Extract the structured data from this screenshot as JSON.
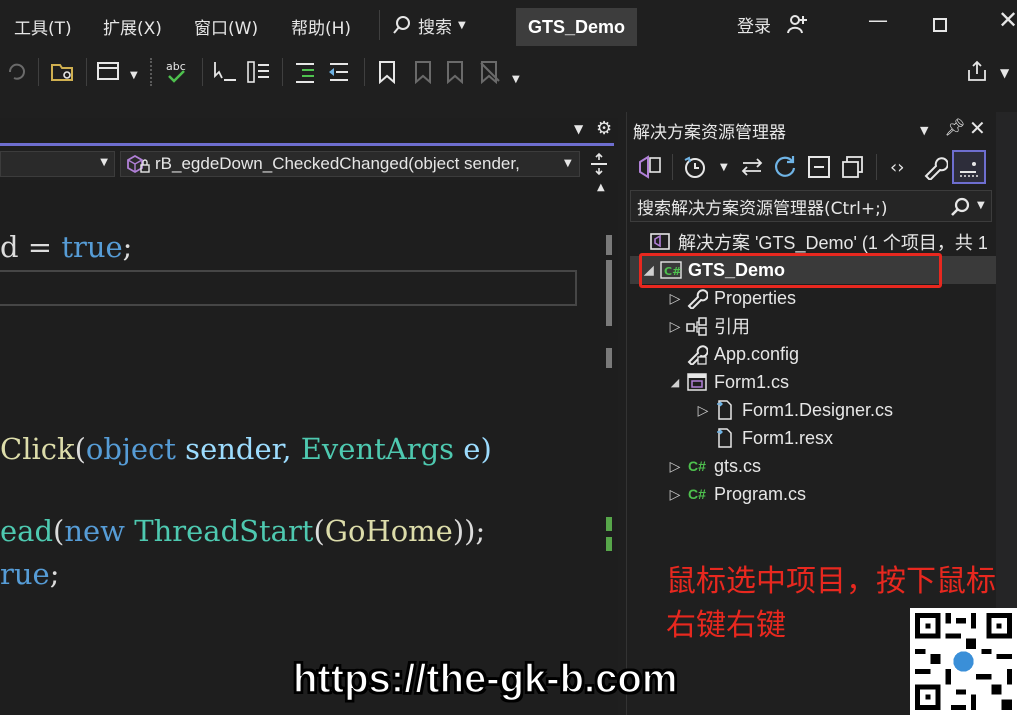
{
  "menu": {
    "items": [
      "工具(T)",
      "扩展(X)",
      "窗口(W)",
      "帮助(H)"
    ],
    "search_label": "搜索",
    "solution_name": "GTS_Demo",
    "login_label": "登录"
  },
  "editor": {
    "nav_member": "rB_egdeDown_CheckedChanged(object sender,",
    "code_lines": [
      {
        "parts": [
          {
            "t": "d = ",
            "c": "#dcdcdc"
          },
          {
            "t": "true",
            "c": "#569cd6"
          },
          {
            "t": ";",
            "c": "#dcdcdc"
          }
        ]
      },
      {
        "parts": [
          {
            "t": "Click",
            "c": "#dcdcaa"
          },
          {
            "t": "(",
            "c": "#dcdcdc"
          },
          {
            "t": "object",
            "c": "#569cd6"
          },
          {
            "t": " sender, ",
            "c": "#9cdcfe"
          },
          {
            "t": "EventArgs",
            "c": "#4ec9b0"
          },
          {
            "t": " e)",
            "c": "#9cdcfe"
          }
        ]
      },
      {
        "parts": [
          {
            "t": "ead",
            "c": "#4ec9b0"
          },
          {
            "t": "(",
            "c": "#dcdcdc"
          },
          {
            "t": "new",
            "c": "#569cd6"
          },
          {
            "t": " ",
            "c": "#dcdcdc"
          },
          {
            "t": "ThreadStart",
            "c": "#4ec9b0"
          },
          {
            "t": "(",
            "c": "#dcdcdc"
          },
          {
            "t": "GoHome",
            "c": "#dcdcaa"
          },
          {
            "t": "));",
            "c": "#dcdcdc"
          }
        ]
      },
      {
        "parts": [
          {
            "t": "rue",
            "c": "#569cd6"
          },
          {
            "t": ";",
            "c": "#dcdcdc"
          }
        ]
      }
    ]
  },
  "solution_explorer": {
    "title": "解决方案资源管理器",
    "search_placeholder": "搜索解决方案资源管理器(Ctrl+;)",
    "solution_label": "解决方案 'GTS_Demo' (1 个项目，共 1",
    "project_label": "GTS_Demo",
    "items": {
      "properties": "Properties",
      "references": "引用",
      "app_config": "App.config",
      "form1": "Form1.cs",
      "form1_designer": "Form1.Designer.cs",
      "form1_resx": "Form1.resx",
      "gts": "gts.cs",
      "program": "Program.cs"
    },
    "cs_badge": "C#"
  },
  "overlay": {
    "annotation": "鼠标选中项目，按下鼠标右键右键",
    "watermark": "https://the-gk-b.com"
  },
  "colors": {
    "highlight": "#e8281f",
    "accent": "#6e6ecf",
    "cs_green": "#4ec14e"
  }
}
